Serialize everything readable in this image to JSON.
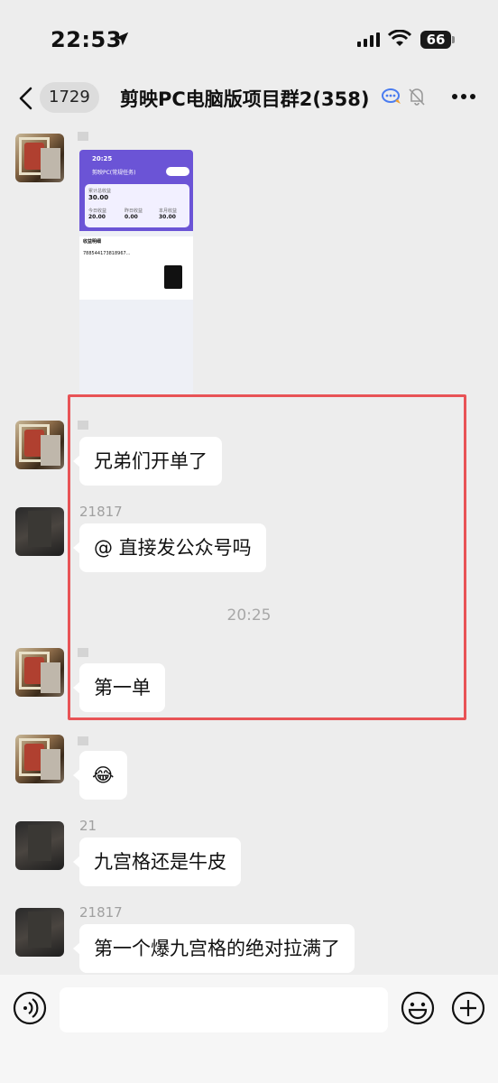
{
  "status": {
    "time": "22:53",
    "battery": "66"
  },
  "nav": {
    "back_count": "1729",
    "title": "剪映PC电脑版项目群2(358)"
  },
  "screenshot_preview": {
    "time": "20:25",
    "title": "剪映PC(常规任务)",
    "total_label": "累计总收益",
    "total_value": "30.00",
    "c1_label": "今日收益",
    "c1_value": "20.00",
    "c2_label": "昨日收益",
    "c2_value": "0.00",
    "c3_label": "本月收益",
    "c3_value": "30.00",
    "list_title": "收益明细",
    "order_id": "788544173818967..."
  },
  "messages": [
    {
      "nick": "",
      "text": ""
    },
    {
      "nick": "",
      "text": "兄弟们开单了"
    },
    {
      "nick": "21817",
      "text": "@ 直接发公众号吗"
    },
    {
      "time": "20:25"
    },
    {
      "nick": "",
      "text": "第一单"
    },
    {
      "nick": "",
      "text": "😂"
    },
    {
      "nick": "21",
      "text": "九宫格还是牛皮"
    },
    {
      "nick": "21817",
      "text": "第一个爆九宫格的绝对拉满了"
    }
  ]
}
